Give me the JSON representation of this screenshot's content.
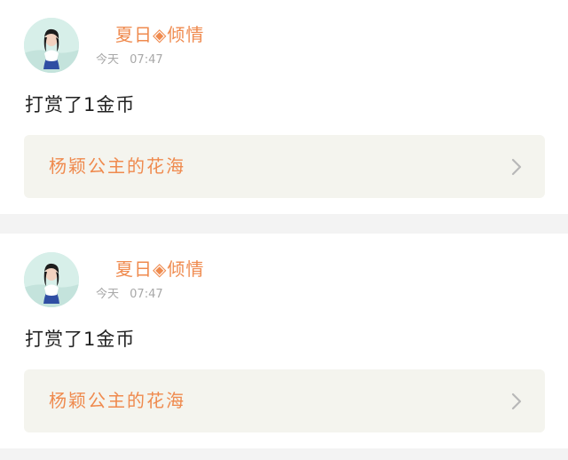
{
  "theme": {
    "accent": "#ef8a4e",
    "link_background": "#f4f4ee",
    "divider": "#f3f3f3",
    "muted_text": "#a8a8a8"
  },
  "feed": [
    {
      "user": {
        "name": "夏日◈倾情",
        "avatar_icon": "user-avatar-photo"
      },
      "time": {
        "day": "今天",
        "clock": "07:47"
      },
      "message": "打赏了1金币",
      "link": {
        "title": "杨颖公主的花海",
        "arrow_icon": "chevron-right-icon"
      }
    },
    {
      "user": {
        "name": "夏日◈倾情",
        "avatar_icon": "user-avatar-photo"
      },
      "time": {
        "day": "今天",
        "clock": "07:47"
      },
      "message": "打赏了1金币",
      "link": {
        "title": "杨颖公主的花海",
        "arrow_icon": "chevron-right-icon"
      }
    }
  ]
}
